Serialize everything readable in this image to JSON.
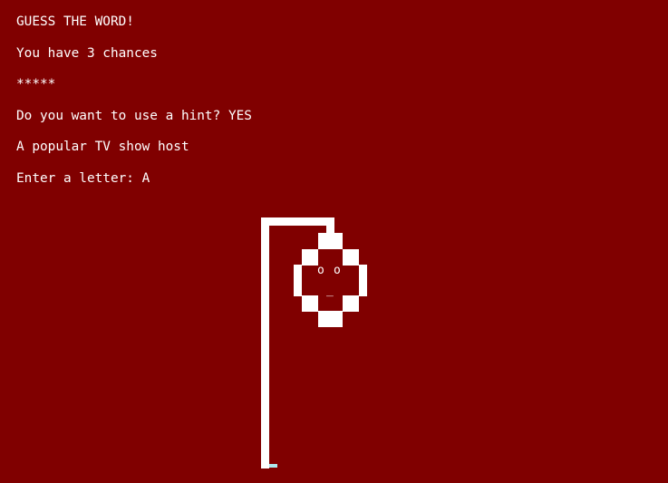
{
  "game": {
    "title": "GUESS THE WORD!",
    "chances_text": "You have 3 chances",
    "masked_word": "*****",
    "hint_prompt": "Do you want to use a hint?",
    "hint_answer": "YES",
    "hint_text": "A popular TV show host",
    "letter_prompt": "Enter a letter:",
    "letter_input": "A"
  },
  "hangman": {
    "left_eye": "o",
    "right_eye": "o",
    "mouth": "_"
  },
  "colors": {
    "background": "#800000",
    "text": "#ffffff",
    "cursor": "#aee8ee"
  }
}
